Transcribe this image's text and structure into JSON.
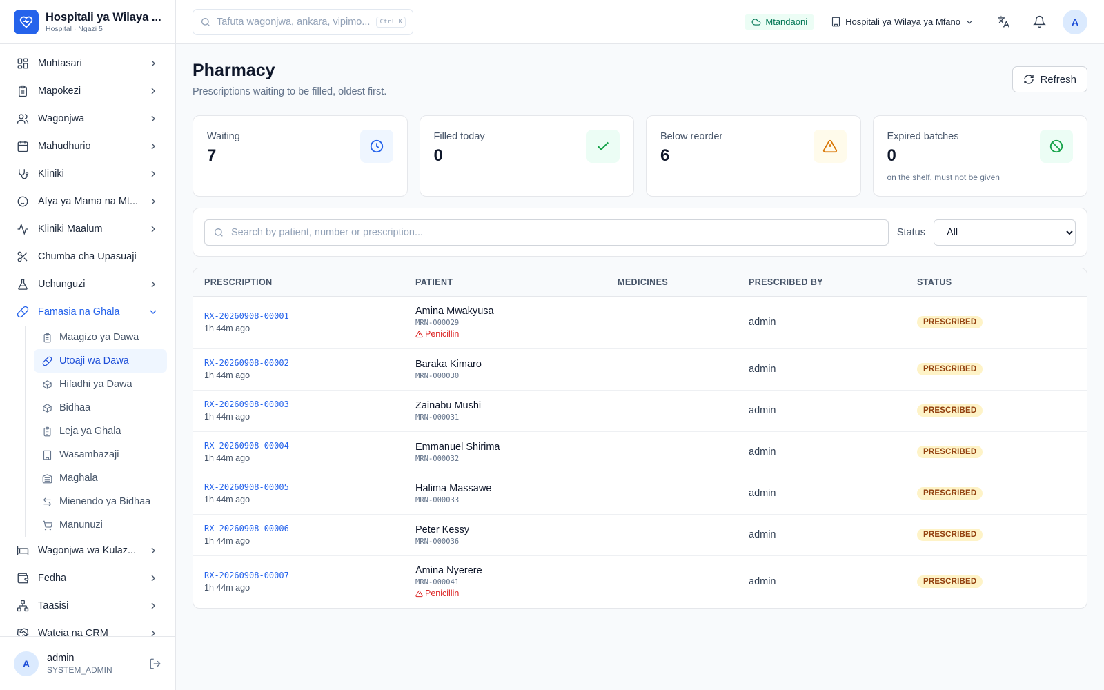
{
  "brand": {
    "title": "Hospitali ya Wilaya ...",
    "subtitle": "Hospital · Ngazi 5"
  },
  "nav": {
    "items": [
      {
        "label": "Muhtasari"
      },
      {
        "label": "Mapokezi"
      },
      {
        "label": "Wagonjwa"
      },
      {
        "label": "Mahudhurio"
      },
      {
        "label": "Kliniki"
      },
      {
        "label": "Afya ya Mama na Mt..."
      },
      {
        "label": "Kliniki Maalum"
      },
      {
        "label": "Chumba cha Upasuaji"
      },
      {
        "label": "Uchunguzi"
      },
      {
        "label": "Famasia na Ghala"
      }
    ],
    "subitems": [
      {
        "label": "Maagizo ya Dawa"
      },
      {
        "label": "Utoaji wa Dawa"
      },
      {
        "label": "Hifadhi ya Dawa"
      },
      {
        "label": "Bidhaa"
      },
      {
        "label": "Leja ya Ghala"
      },
      {
        "label": "Wasambazaji"
      },
      {
        "label": "Maghala"
      },
      {
        "label": "Mienendo ya Bidhaa"
      },
      {
        "label": "Manunuzi"
      }
    ],
    "after": [
      {
        "label": "Wagonjwa wa Kulaz..."
      },
      {
        "label": "Fedha"
      },
      {
        "label": "Taasisi"
      },
      {
        "label": "Wateja na CRM"
      }
    ]
  },
  "user": {
    "avatar": "A",
    "name": "admin",
    "role": "SYSTEM_ADMIN"
  },
  "topbar": {
    "search_placeholder": "Tafuta wagonjwa, ankara, vipimo...",
    "shortcut": "Ctrl K",
    "online": "Mtandaoni",
    "facility": "Hospitali ya Wilaya ya Mfano",
    "avatar": "A"
  },
  "page": {
    "title": "Pharmacy",
    "subtitle": "Prescriptions waiting to be filled, oldest first.",
    "refresh": "Refresh"
  },
  "stats": [
    {
      "label": "Waiting",
      "value": "7",
      "note": "",
      "color": "#2563eb"
    },
    {
      "label": "Filled today",
      "value": "0",
      "note": "",
      "color": "#16a34a"
    },
    {
      "label": "Below reorder",
      "value": "6",
      "note": "",
      "color": "#d97706"
    },
    {
      "label": "Expired batches",
      "value": "0",
      "note": "on the shelf, must not be given",
      "color": "#16a34a"
    }
  ],
  "filter": {
    "search_placeholder": "Search by patient, number or prescription...",
    "status_label": "Status",
    "status_value": "All"
  },
  "table": {
    "headers": [
      "PRESCRIPTION",
      "PATIENT",
      "MEDICINES",
      "PRESCRIBED BY",
      "STATUS"
    ],
    "rows": [
      {
        "rx": "RX-20260908-00001",
        "ago": "1h 44m ago",
        "patient": "Amina Mwakyusa",
        "mrn": "MRN-000029",
        "allergy": "Penicillin",
        "medicines": "",
        "by": "admin",
        "status": "PRESCRIBED"
      },
      {
        "rx": "RX-20260908-00002",
        "ago": "1h 44m ago",
        "patient": "Baraka Kimaro",
        "mrn": "MRN-000030",
        "allergy": "",
        "medicines": "",
        "by": "admin",
        "status": "PRESCRIBED"
      },
      {
        "rx": "RX-20260908-00003",
        "ago": "1h 44m ago",
        "patient": "Zainabu Mushi",
        "mrn": "MRN-000031",
        "allergy": "",
        "medicines": "",
        "by": "admin",
        "status": "PRESCRIBED"
      },
      {
        "rx": "RX-20260908-00004",
        "ago": "1h 44m ago",
        "patient": "Emmanuel Shirima",
        "mrn": "MRN-000032",
        "allergy": "",
        "medicines": "",
        "by": "admin",
        "status": "PRESCRIBED"
      },
      {
        "rx": "RX-20260908-00005",
        "ago": "1h 44m ago",
        "patient": "Halima Massawe",
        "mrn": "MRN-000033",
        "allergy": "",
        "medicines": "",
        "by": "admin",
        "status": "PRESCRIBED"
      },
      {
        "rx": "RX-20260908-00006",
        "ago": "1h 44m ago",
        "patient": "Peter Kessy",
        "mrn": "MRN-000036",
        "allergy": "",
        "medicines": "",
        "by": "admin",
        "status": "PRESCRIBED"
      },
      {
        "rx": "RX-20260908-00007",
        "ago": "1h 44m ago",
        "patient": "Amina Nyerere",
        "mrn": "MRN-000041",
        "allergy": "Penicillin",
        "medicines": "",
        "by": "admin",
        "status": "PRESCRIBED"
      }
    ]
  }
}
